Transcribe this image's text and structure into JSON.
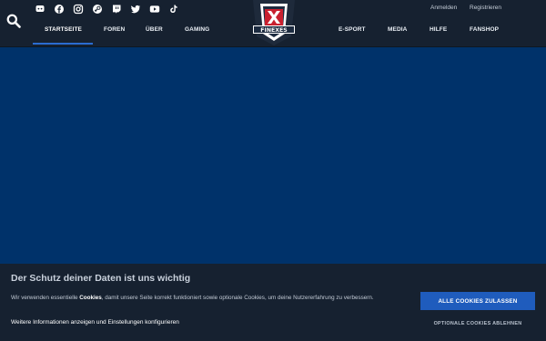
{
  "header": {
    "social_icons": [
      "discord-icon",
      "facebook-icon",
      "instagram-icon",
      "steam-icon",
      "twitch-icon",
      "twitter-icon",
      "youtube-icon",
      "tiktok-icon"
    ],
    "nav_left": [
      "STARTSEITE",
      "FOREN",
      "ÜBER",
      "GAMING"
    ],
    "nav_right": [
      "E-SPORT",
      "MEDIA",
      "HILFE",
      "FANSHOP"
    ],
    "active_nav": "STARTSEITE",
    "login_label": "Anmelden",
    "register_label": "Registrieren",
    "logo_text": "FINEXES"
  },
  "cookie_banner": {
    "title": "Der Schutz deiner Daten ist uns wichtig",
    "text_before": "Wir verwenden essentielle ",
    "text_bold": "Cookies",
    "text_after": ", damit unsere Seite korrekt funktioniert sowie optionale Cookies, um deine Nutzererfahrung zu verbessern.",
    "more_link": "Weitere Informationen anzeigen und Einstellungen konfigurieren",
    "accept_label": "ALLE COOKIES ZULASSEN",
    "decline_label": "OPTIONALE COOKIES ABLEHNEN"
  },
  "colors": {
    "header_bg": "#162130",
    "page_bg": "#00326a",
    "accent": "#1f5cbd",
    "logo_red": "#c8202f"
  }
}
